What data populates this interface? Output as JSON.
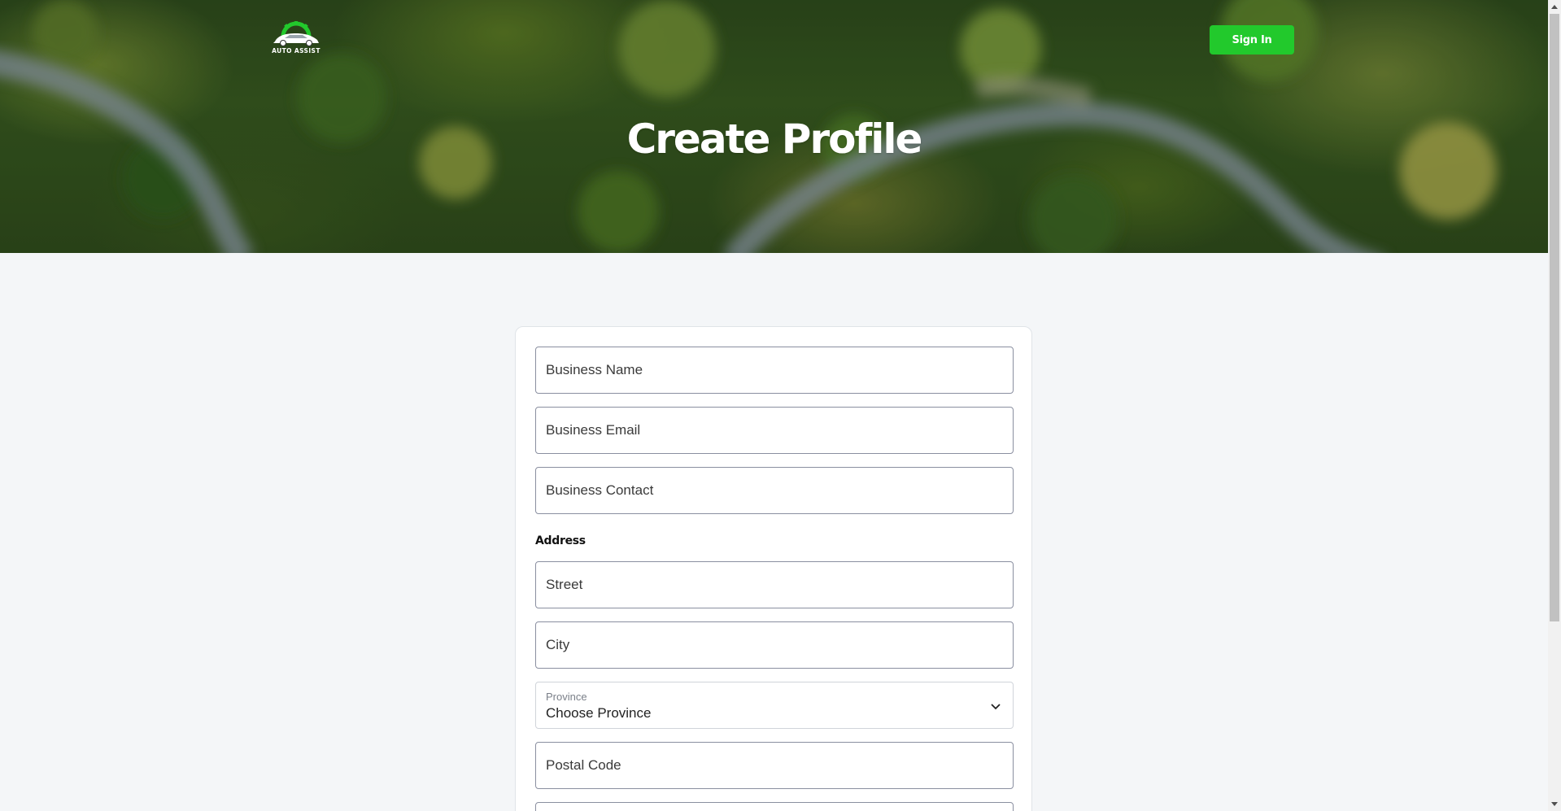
{
  "header": {
    "logo_text": "AUTO ASSIST",
    "signin_label": "Sign In",
    "title": "Create Profile"
  },
  "form": {
    "business_name": {
      "placeholder": "Business Name",
      "value": ""
    },
    "business_email": {
      "placeholder": "Business Email",
      "value": ""
    },
    "business_contact": {
      "placeholder": "Business Contact",
      "value": ""
    },
    "address_label": "Address",
    "street": {
      "placeholder": "Street",
      "value": ""
    },
    "city": {
      "placeholder": "City",
      "value": ""
    },
    "province": {
      "label": "Province",
      "selected": "Choose Province"
    },
    "postal_code": {
      "placeholder": "Postal Code",
      "value": ""
    }
  },
  "colors": {
    "accent": "#22c92c",
    "page_background": "#f4f6f8",
    "field_border": "#8a8fa0"
  },
  "icons": {
    "logo": "car-gear-logo-icon",
    "province_dropdown": "chevron-down-icon",
    "scroll_up": "triangle-up-icon",
    "scroll_down": "triangle-down-icon"
  }
}
